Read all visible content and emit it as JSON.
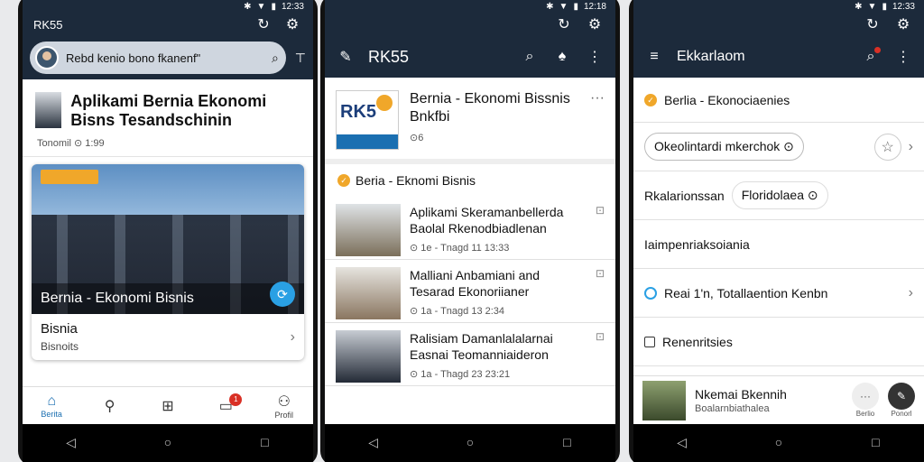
{
  "status": {
    "time1": "12:33",
    "time2": "12:18",
    "time3": "12:33"
  },
  "phone1": {
    "app_title": "RK55",
    "search_text": "Rebd kenio bono fkanenf\"",
    "headline": "Aplikami Bernia Ekonomi Bisns Tesandschinin",
    "meta": "Tonomil ⊙ 1:99",
    "card_caption": "Bernia - Ekonomi Bisnis",
    "card_title": "Bisnia",
    "card_sub": "Bisnoits",
    "tabs": [
      {
        "label": "Berita",
        "icon": "home"
      },
      {
        "label": "",
        "icon": "search"
      },
      {
        "label": "",
        "icon": "grid"
      },
      {
        "label": "",
        "icon": "inbox",
        "badge": "1"
      },
      {
        "label": "Profil",
        "icon": "person"
      }
    ]
  },
  "phone2": {
    "app_title": "RK55",
    "featured_logo": "RK5",
    "featured_title": "Bernia - Ekonomi Bissnis Bnkfbi",
    "featured_meta": "⊙6",
    "section": "Beria - Eknomi Bisnis",
    "news": [
      {
        "title": "Aplikami Skeramanbellerda Baolal Rkenodbiadlenan",
        "meta": "⊙ 1e - Tnagd 11 13:33"
      },
      {
        "title": "Malliani Anbamiani and Tesarad Ekonoriianer",
        "meta": "⊙ 1a - Tnagd 13 2:34"
      },
      {
        "title": "Ralisiam Damanlalalarnai Easnai Teomanniaideron",
        "meta": "⊙ 1a - Thagd 23 23:21"
      }
    ]
  },
  "phone3": {
    "app_title": "Ekkarlaom",
    "section": "Berlia - Ekonociaenies",
    "chip1": "Okeolintardi mkerchok ⊙",
    "row2_label": "Rkalarionssan",
    "chip2": "Floridolaea ⊙",
    "row3_label": "Iaimpenriaksoiania",
    "row4_label": "Reai 1'n, Totallaention Kenbn",
    "row5_label": "Renenritsies",
    "player_title": "Nkemai Bkennih",
    "player_sub": "Boalarnbiathalea",
    "player_btn1": "Berlio",
    "player_btn2": "Ponorl"
  },
  "colors": {
    "appbar": "#1c2a3b",
    "accent": "#2aa0e4",
    "orange": "#f0a72a",
    "badge": "#d93025"
  }
}
